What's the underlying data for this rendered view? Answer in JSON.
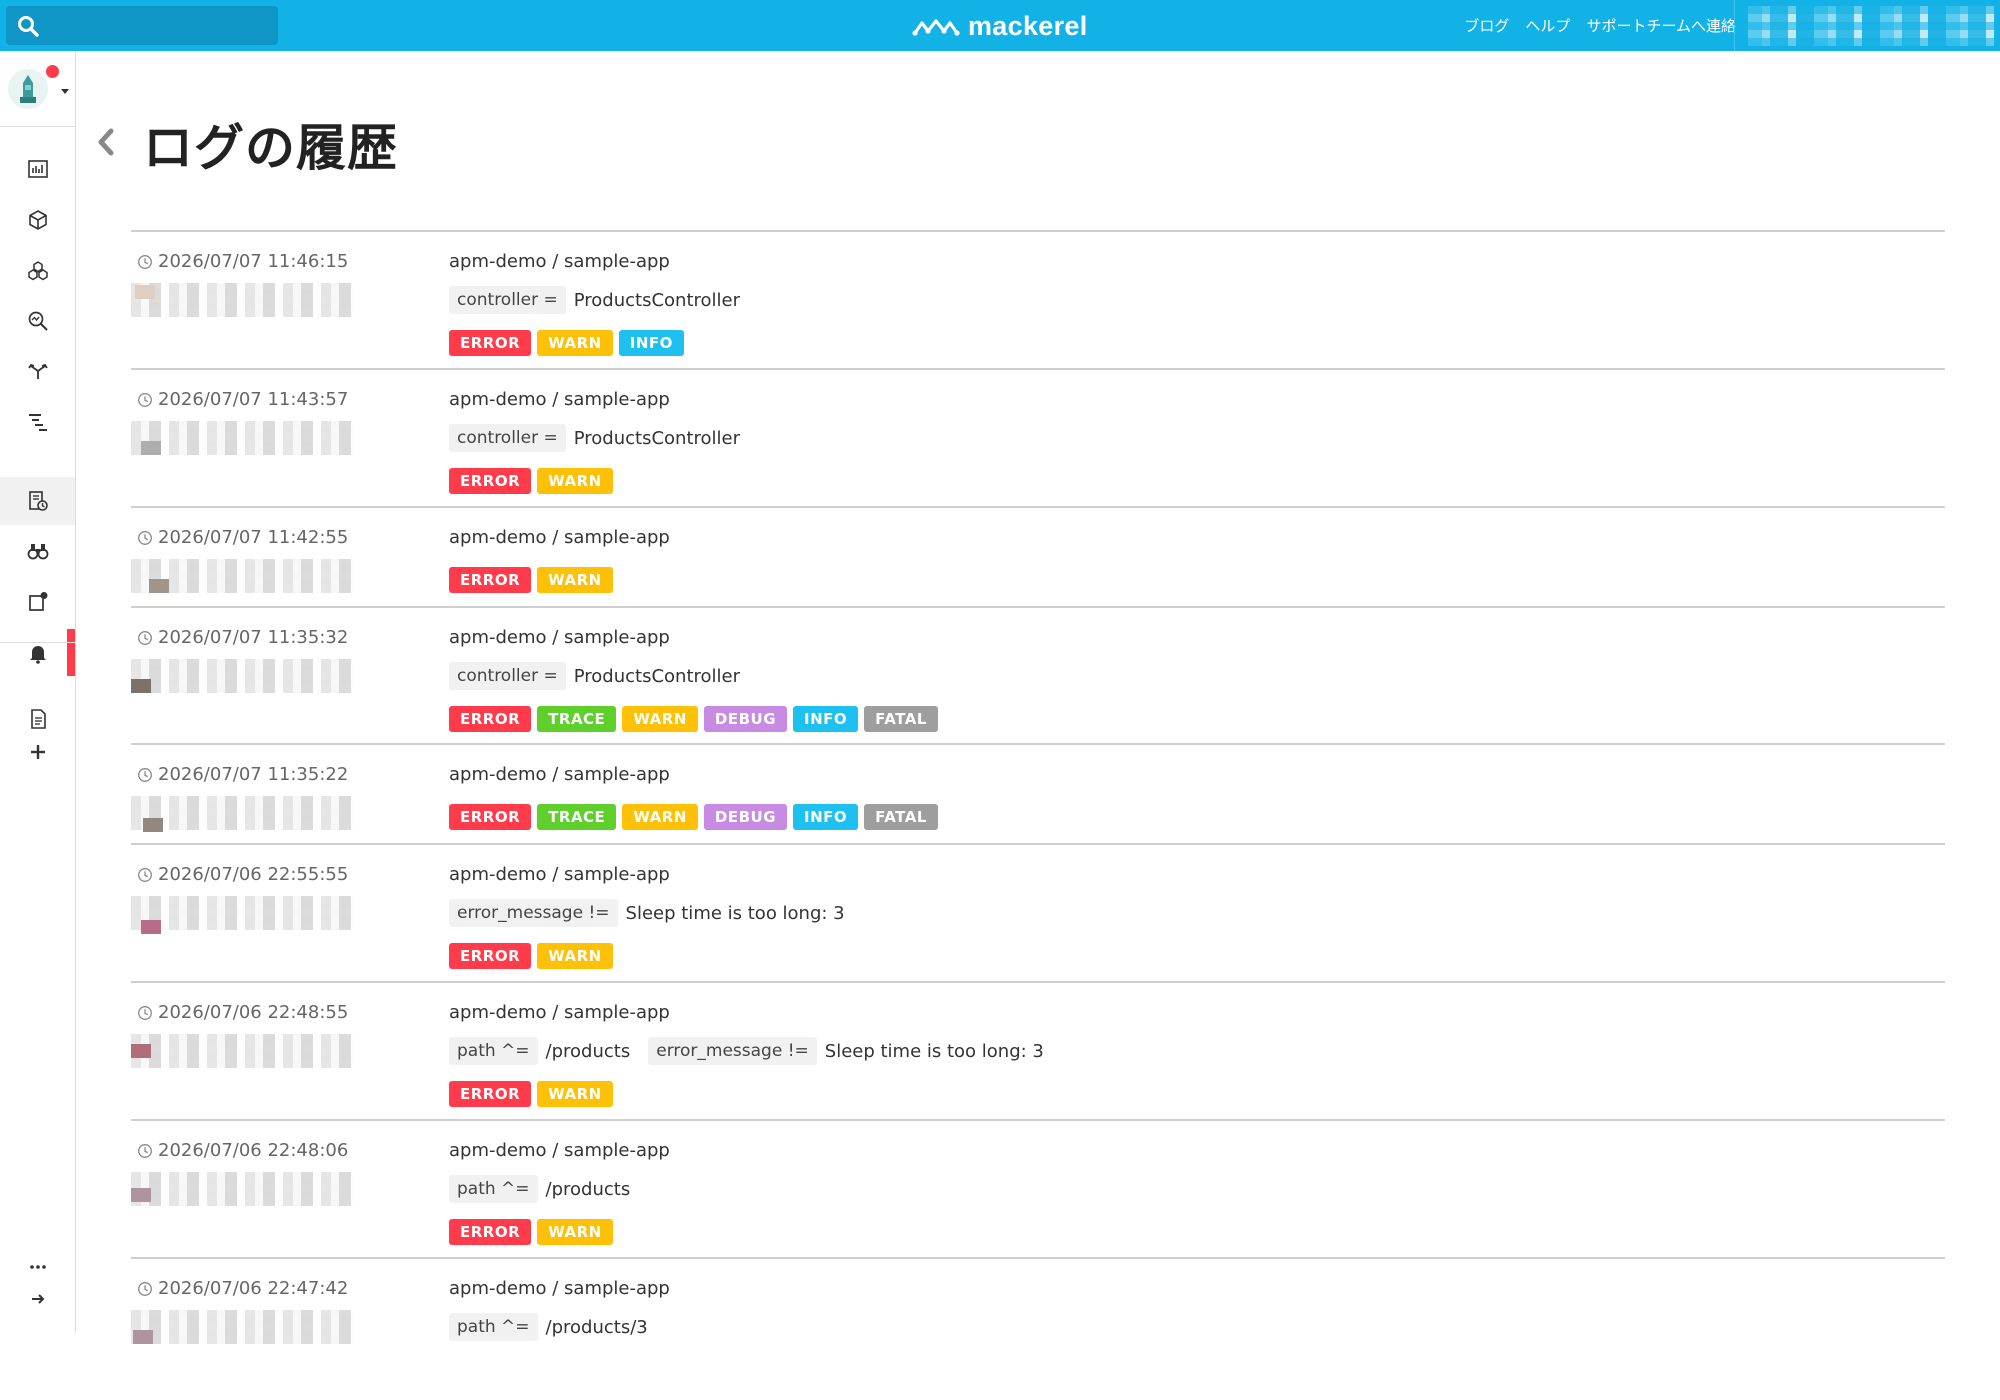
{
  "header": {
    "brand": "mackerel",
    "nav": [
      "ブログ",
      "ヘルプ",
      "サポートチームへ連絡"
    ]
  },
  "sidebar": {
    "items": [
      {
        "name": "dashboard-icon"
      },
      {
        "name": "hosts-icon"
      },
      {
        "name": "services-icon"
      },
      {
        "name": "trace-search-icon"
      },
      {
        "name": "connections-icon"
      },
      {
        "name": "traces-icon"
      },
      {
        "name": "logs-history-icon",
        "active": true
      },
      {
        "name": "binoculars-icon"
      },
      {
        "name": "monitors-icon"
      },
      {
        "name": "alerts-icon"
      }
    ],
    "bottom": [
      {
        "name": "document-icon"
      },
      {
        "name": "add-icon"
      }
    ],
    "footer": [
      {
        "name": "more-icon"
      },
      {
        "name": "collapse-icon"
      }
    ]
  },
  "page": {
    "title": "ログの履歴"
  },
  "colors": {
    "ERROR": "#ff3b4c",
    "WARN": "#ffc107",
    "INFO": "#1ec0ef",
    "TRACE": "#5fcf2c",
    "DEBUG": "#c78be3",
    "FATAL": "#9e9e9e"
  },
  "entries": [
    {
      "timestamp": "2026/07/07 11:46:15",
      "service": "apm-demo / sample-app",
      "filters": [
        {
          "key": "controller =",
          "value": "ProductsController"
        }
      ],
      "levels": [
        "ERROR",
        "WARN",
        "INFO"
      ]
    },
    {
      "timestamp": "2026/07/07 11:43:57",
      "service": "apm-demo / sample-app",
      "filters": [
        {
          "key": "controller =",
          "value": "ProductsController"
        }
      ],
      "levels": [
        "ERROR",
        "WARN"
      ]
    },
    {
      "timestamp": "2026/07/07 11:42:55",
      "service": "apm-demo / sample-app",
      "filters": [],
      "levels": [
        "ERROR",
        "WARN"
      ]
    },
    {
      "timestamp": "2026/07/07 11:35:32",
      "service": "apm-demo / sample-app",
      "filters": [
        {
          "key": "controller =",
          "value": "ProductsController"
        }
      ],
      "levels": [
        "ERROR",
        "TRACE",
        "WARN",
        "DEBUG",
        "INFO",
        "FATAL"
      ]
    },
    {
      "timestamp": "2026/07/07 11:35:22",
      "service": "apm-demo / sample-app",
      "filters": [],
      "levels": [
        "ERROR",
        "TRACE",
        "WARN",
        "DEBUG",
        "INFO",
        "FATAL"
      ]
    },
    {
      "timestamp": "2026/07/06 22:55:55",
      "service": "apm-demo / sample-app",
      "filters": [
        {
          "key": "error_message !=",
          "value": "Sleep time is too long: 3"
        }
      ],
      "levels": [
        "ERROR",
        "WARN"
      ]
    },
    {
      "timestamp": "2026/07/06 22:48:55",
      "service": "apm-demo / sample-app",
      "filters": [
        {
          "key": "path ^=",
          "value": "/products"
        },
        {
          "key": "error_message !=",
          "value": "Sleep time is too long: 3"
        }
      ],
      "levels": [
        "ERROR",
        "WARN"
      ]
    },
    {
      "timestamp": "2026/07/06 22:48:06",
      "service": "apm-demo / sample-app",
      "filters": [
        {
          "key": "path ^=",
          "value": "/products"
        }
      ],
      "levels": [
        "ERROR",
        "WARN"
      ]
    },
    {
      "timestamp": "2026/07/06 22:47:42",
      "service": "apm-demo / sample-app",
      "filters": [
        {
          "key": "path ^=",
          "value": "/products/3"
        }
      ],
      "levels": []
    }
  ]
}
